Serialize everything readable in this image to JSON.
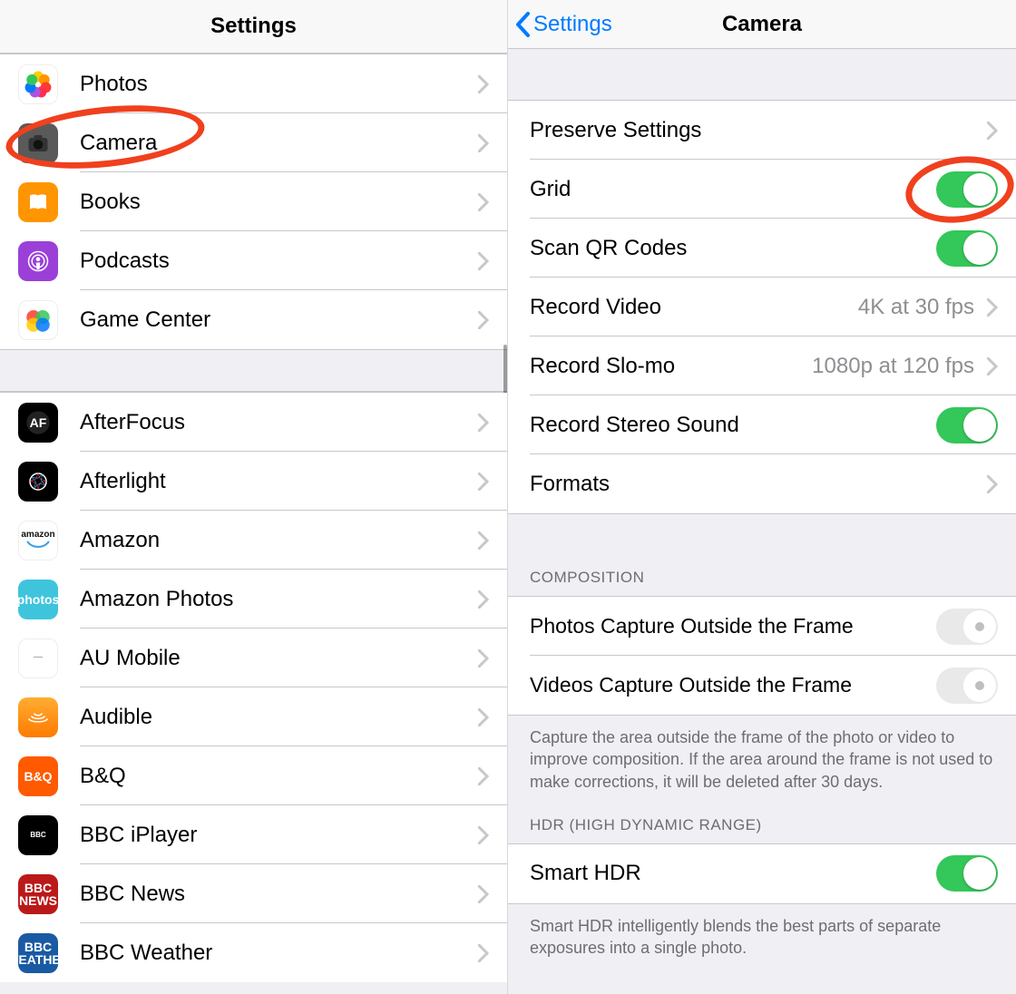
{
  "left": {
    "title": "Settings",
    "groups": [
      [
        {
          "key": "photos",
          "label": "Photos"
        },
        {
          "key": "camera",
          "label": "Camera"
        },
        {
          "key": "books",
          "label": "Books"
        },
        {
          "key": "podcasts",
          "label": "Podcasts"
        },
        {
          "key": "gamecenter",
          "label": "Game Center"
        }
      ],
      [
        {
          "key": "afterfocus",
          "label": "AfterFocus"
        },
        {
          "key": "afterlight",
          "label": "Afterlight"
        },
        {
          "key": "amazon",
          "label": "Amazon"
        },
        {
          "key": "amazonphotos",
          "label": "Amazon Photos"
        },
        {
          "key": "aumobile",
          "label": "AU Mobile"
        },
        {
          "key": "audible",
          "label": "Audible"
        },
        {
          "key": "bq",
          "label": "B&Q"
        },
        {
          "key": "bbciplayer",
          "label": "BBC iPlayer"
        },
        {
          "key": "bbcnews",
          "label": "BBC News"
        },
        {
          "key": "bbcweather",
          "label": "BBC Weather"
        }
      ]
    ]
  },
  "right": {
    "back_label": "Settings",
    "title": "Camera",
    "rows": {
      "preserve": "Preserve Settings",
      "grid": "Grid",
      "scanqr": "Scan QR Codes",
      "recvideo_label": "Record Video",
      "recvideo_value": "4K at 30 fps",
      "slomo_label": "Record Slo-mo",
      "slomo_value": "1080p at 120 fps",
      "stereo": "Record Stereo Sound",
      "formats": "Formats"
    },
    "composition": {
      "header": "COMPOSITION",
      "photos_outside": "Photos Capture Outside the Frame",
      "videos_outside": "Videos Capture Outside the Frame",
      "footer": "Capture the area outside the frame of the photo or video to improve composition. If the area around the frame is not used to make corrections, it will be deleted after 30 days."
    },
    "hdr": {
      "header": "HDR (HIGH DYNAMIC RANGE)",
      "smart_hdr": "Smart HDR",
      "footer": "Smart HDR intelligently blends the best parts of separate exposures into a single photo."
    },
    "toggles": {
      "grid": true,
      "scanqr": true,
      "stereo": true,
      "photos_outside": false,
      "videos_outside": false,
      "smart_hdr": true
    }
  },
  "colors": {
    "tint": "#007aff",
    "toggle_on": "#34c759",
    "annotation": "#f0401e"
  }
}
